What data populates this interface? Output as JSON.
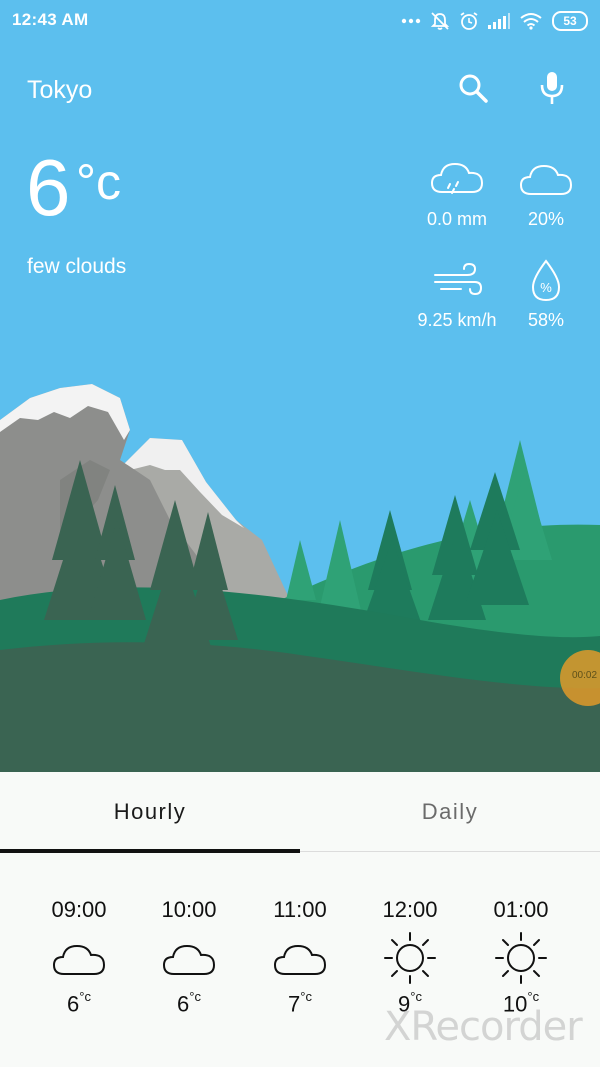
{
  "status_bar": {
    "time": "12:43 AM",
    "battery": "53"
  },
  "header": {
    "city": "Tokyo",
    "search_icon": "search-icon",
    "mic_icon": "mic-icon"
  },
  "current": {
    "temperature": "6",
    "unit": "°c",
    "condition": "few clouds",
    "precipitation": "0.0 mm",
    "cloudiness": "20%",
    "wind": "9.25 km/h",
    "humidity": "58%"
  },
  "tabs": {
    "hourly": "Hourly",
    "daily": "Daily",
    "selected": "hourly"
  },
  "hourly": [
    {
      "time": "09:00",
      "icon": "cloud-icon",
      "temp": "6",
      "unit": "°c"
    },
    {
      "time": "10:00",
      "icon": "cloud-icon",
      "temp": "6",
      "unit": "°c"
    },
    {
      "time": "11:00",
      "icon": "cloud-icon",
      "temp": "7",
      "unit": "°c"
    },
    {
      "time": "12:00",
      "icon": "sun-icon",
      "temp": "9",
      "unit": "°c"
    },
    {
      "time": "01:00",
      "icon": "sun-icon",
      "temp": "10",
      "unit": "°c"
    }
  ],
  "overlay": {
    "recorder_time": "00:02",
    "watermark": "XRecorder"
  },
  "colors": {
    "sky": "#5cbfee",
    "forest_dark": "#3a6452",
    "forest_mid": "#1e7b5c",
    "forest_light": "#2a9a6e",
    "mountain": "#9a9a9a",
    "snow": "#f2f2f2"
  }
}
